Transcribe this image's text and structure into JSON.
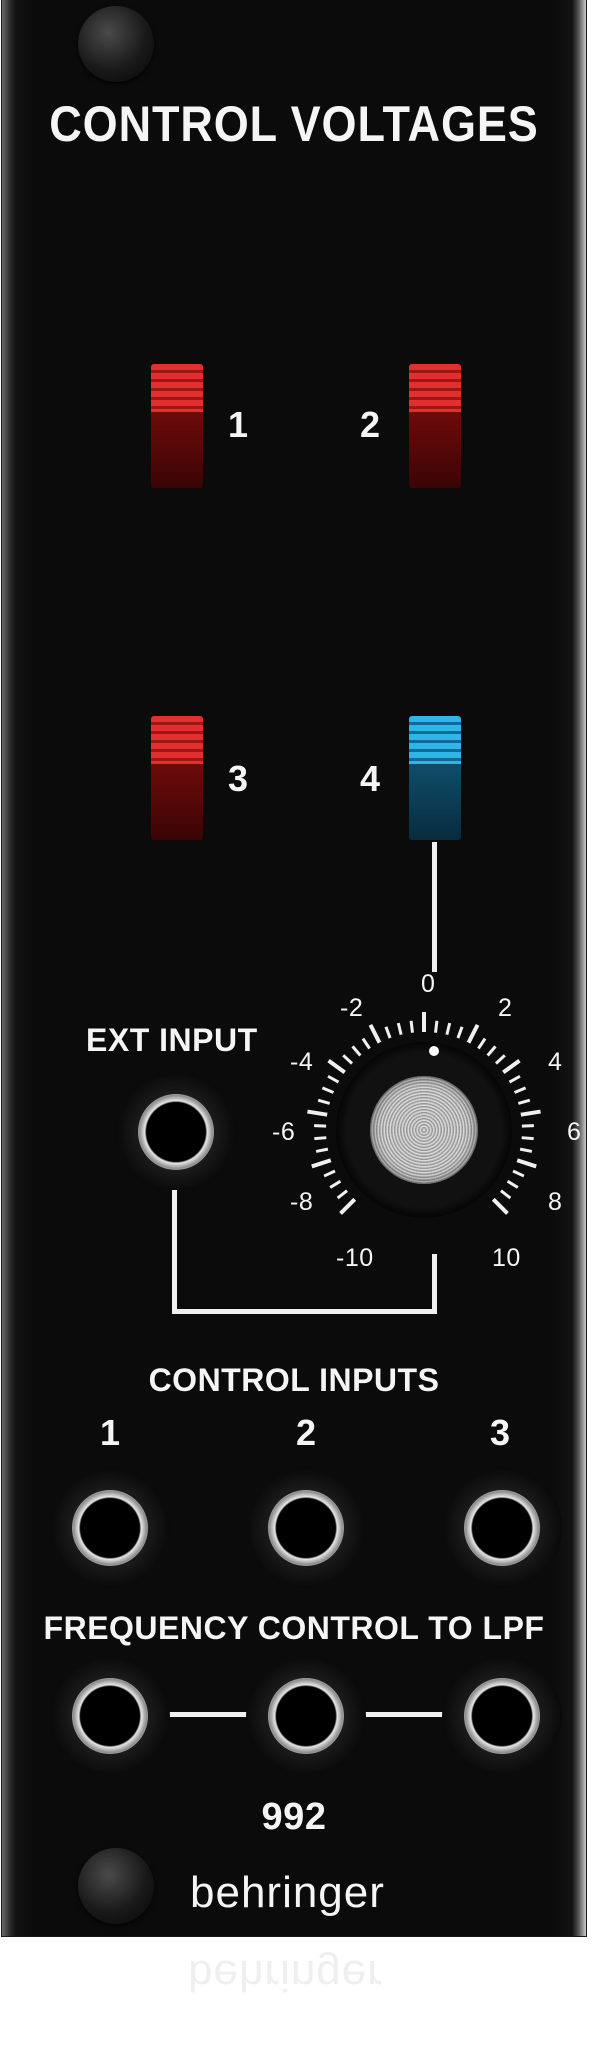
{
  "panel": {
    "title": "CONTROL VOLTAGES",
    "model": "992",
    "brand": "behringer"
  },
  "switches": [
    {
      "label": "1",
      "color": "#e23030"
    },
    {
      "label": "2",
      "color": "#e23030"
    },
    {
      "label": "3",
      "color": "#e23030"
    },
    {
      "label": "4",
      "color": "#2fb6e8"
    }
  ],
  "ext_input": {
    "label": "EXT INPUT"
  },
  "dial": {
    "labels": [
      "-10",
      "-8",
      "-6",
      "-4",
      "-2",
      "0",
      "2",
      "4",
      "6",
      "8",
      "10"
    ]
  },
  "control_inputs": {
    "label": "CONTROL INPUTS",
    "jacks": [
      "1",
      "2",
      "3"
    ]
  },
  "frequency_control": {
    "label": "FREQUENCY CONTROL TO LPF"
  }
}
